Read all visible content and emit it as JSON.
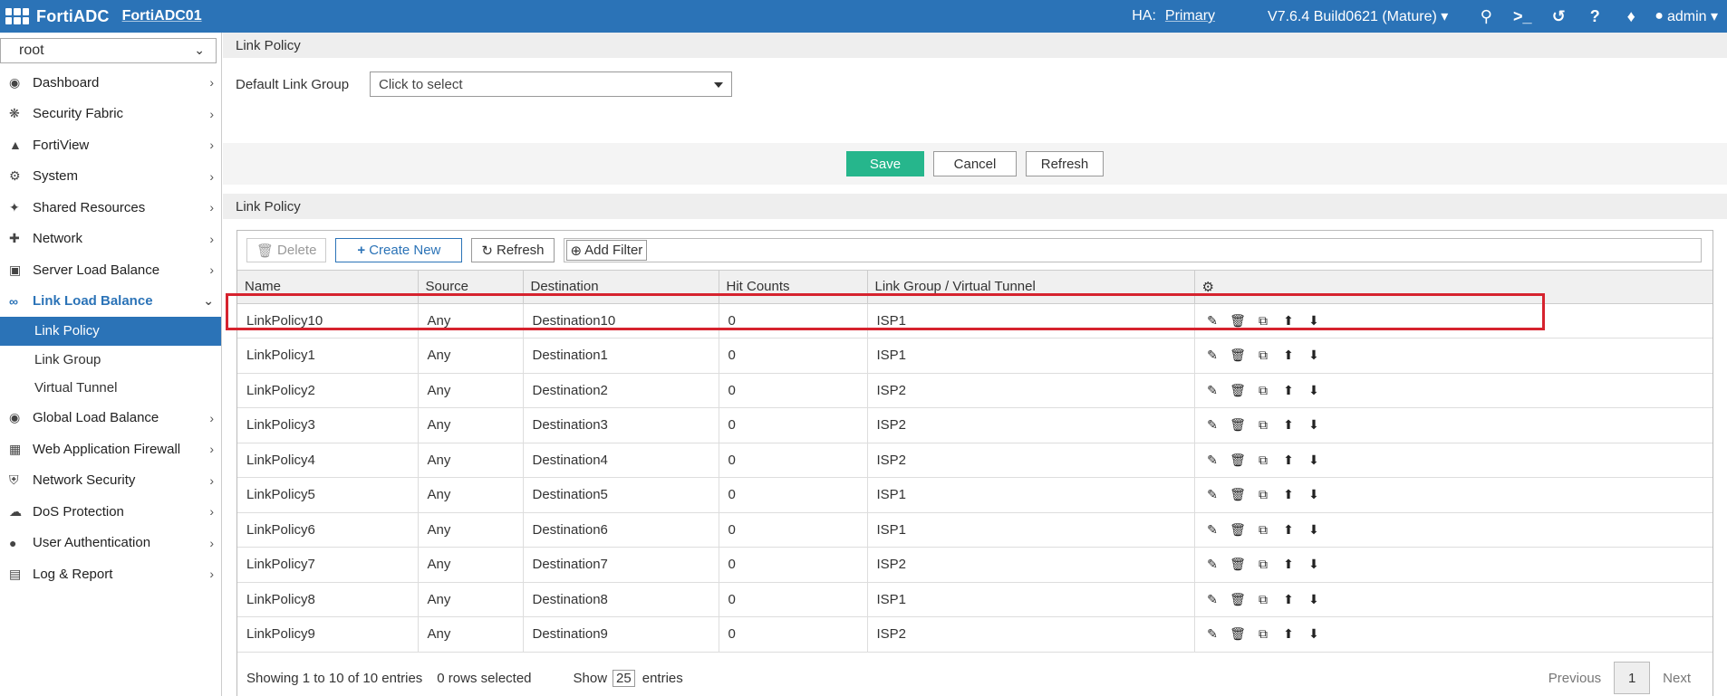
{
  "topbar": {
    "brand": "FortiADC",
    "hostname": "FortiADC01",
    "ha_label": "HA:",
    "ha_value": "Primary",
    "version": "V7.6.4 Build0621 (Mature) ▾",
    "user": "admin ▾"
  },
  "sidebar": {
    "vdom": "root",
    "items": [
      {
        "label": "Dashboard",
        "icon": "dashboard-icon"
      },
      {
        "label": "Security Fabric",
        "icon": "fabric-icon"
      },
      {
        "label": "FortiView",
        "icon": "chart-icon"
      },
      {
        "label": "System",
        "icon": "gear-icon"
      },
      {
        "label": "Shared Resources",
        "icon": "share-icon"
      },
      {
        "label": "Network",
        "icon": "network-icon"
      },
      {
        "label": "Server Load Balance",
        "icon": "slb-icon"
      },
      {
        "label": "Link Load Balance",
        "icon": "link-icon"
      }
    ],
    "sub_items": [
      "Link Policy",
      "Link Group",
      "Virtual Tunnel"
    ],
    "items_after": [
      {
        "label": "Global Load Balance",
        "icon": "globe-icon"
      },
      {
        "label": "Web Application Firewall",
        "icon": "waf-icon"
      },
      {
        "label": "Network Security",
        "icon": "shield-icon"
      },
      {
        "label": "DoS Protection",
        "icon": "cloud-icon"
      },
      {
        "label": "User Authentication",
        "icon": "user-icon"
      },
      {
        "label": "Log & Report",
        "icon": "report-icon"
      }
    ]
  },
  "main": {
    "section1": "Link Policy",
    "default_group_label": "Default Link Group",
    "default_group_placeholder": "Click to select",
    "save": "Save",
    "cancel": "Cancel",
    "refresh": "Refresh",
    "section2": "Link Policy",
    "toolbar": {
      "delete": "Delete",
      "create": "Create New",
      "refresh": "Refresh",
      "add_filter": "Add Filter"
    },
    "columns": [
      "Name",
      "Source",
      "Destination",
      "Hit Counts",
      "Link Group / Virtual Tunnel"
    ],
    "rows": [
      [
        "LinkPolicy10",
        "Any",
        "Destination10",
        "0",
        "ISP1"
      ],
      [
        "LinkPolicy1",
        "Any",
        "Destination1",
        "0",
        "ISP1"
      ],
      [
        "LinkPolicy2",
        "Any",
        "Destination2",
        "0",
        "ISP2"
      ],
      [
        "LinkPolicy3",
        "Any",
        "Destination3",
        "0",
        "ISP2"
      ],
      [
        "LinkPolicy4",
        "Any",
        "Destination4",
        "0",
        "ISP2"
      ],
      [
        "LinkPolicy5",
        "Any",
        "Destination5",
        "0",
        "ISP1"
      ],
      [
        "LinkPolicy6",
        "Any",
        "Destination6",
        "0",
        "ISP1"
      ],
      [
        "LinkPolicy7",
        "Any",
        "Destination7",
        "0",
        "ISP2"
      ],
      [
        "LinkPolicy8",
        "Any",
        "Destination8",
        "0",
        "ISP1"
      ],
      [
        "LinkPolicy9",
        "Any",
        "Destination9",
        "0",
        "ISP2"
      ]
    ],
    "footer": {
      "showing": "Showing 1 to 10 of 10 entries",
      "selected": "0 rows selected",
      "show": "Show",
      "page_size": "25",
      "entries": "entries",
      "previous": "Previous",
      "page": "1",
      "next": "Next"
    }
  },
  "colors": {
    "accent": "#2b73b7",
    "save": "#26b68c",
    "highlight": "#d6232e"
  }
}
